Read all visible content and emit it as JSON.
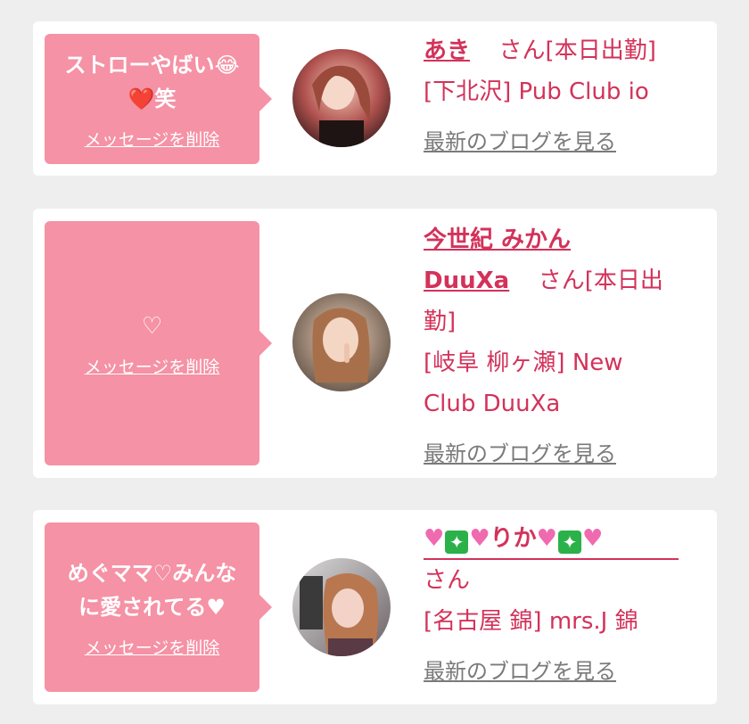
{
  "common": {
    "delete_label": "メッセージを削除",
    "blog_label": "最新のブログを見る",
    "san": "さん",
    "shukkin": "[本日出勤]"
  },
  "cards": [
    {
      "message_line1": "ストローやばい😂",
      "message_line2": "❤️笑",
      "name": "あき",
      "suffix": "さん[本日出勤]",
      "shop": "[下北沢] Pub Club io"
    },
    {
      "message_line1": "♡",
      "name_line1": "今世紀 みかん",
      "name_line2": "DuuXa",
      "suffix_line1": "さん[本日出",
      "suffix_line2": "勤]",
      "shop_line1": "[岐阜 柳ヶ瀬] New",
      "shop_line2": "Club DuuXa"
    },
    {
      "message_line1": "めぐママ♡みんな",
      "message_line2": "に愛されてる♥",
      "name": "りか",
      "suffix": "さん",
      "shop": "[名古屋 錦] mrs.J 錦"
    }
  ],
  "colors": {
    "bubble": "#f592a5",
    "link": "#d3325a",
    "muted": "#7a7a7a"
  }
}
